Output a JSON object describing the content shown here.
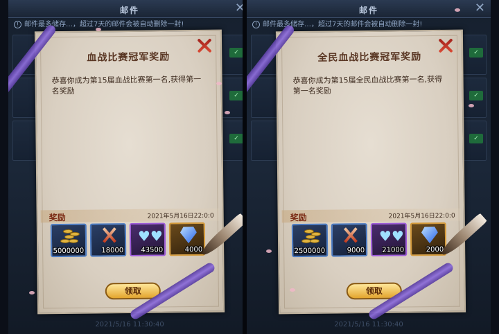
{
  "panels": [
    {
      "window_title": "邮件",
      "notice": "邮件最多储存…，超过7天的邮件会被自动删除一封!",
      "bg_date": "2021/5/16 11:30:40",
      "mail": {
        "title": "血战比赛冠军奖励",
        "body": "恭喜你成为第15届血战比赛第一名,获得第一名奖励",
        "reward_label": "奖励",
        "date": "2021年5月16日22:0:0",
        "rewards": [
          {
            "icon": "gold-coins-icon",
            "qty": "5000000"
          },
          {
            "icon": "crossed-swords-icon",
            "qty": "18000"
          },
          {
            "icon": "blue-hearts-icon",
            "qty": "43500"
          },
          {
            "icon": "diamond-icon",
            "qty": "4000"
          }
        ],
        "claim_label": "领取"
      }
    },
    {
      "window_title": "邮件",
      "notice": "邮件最多储存…，超过7天的邮件会被自动删除一封!",
      "bg_date": "2021/5/16 11:30:40",
      "mail": {
        "title": "全民血战比赛冠军奖励",
        "body": "恭喜你成为第15届全民血战比赛第一名,获得第一名奖励",
        "reward_label": "奖励",
        "date": "2021年5月16日22:0:0",
        "rewards": [
          {
            "icon": "gold-coins-icon",
            "qty": "2500000"
          },
          {
            "icon": "crossed-swords-icon",
            "qty": "9000"
          },
          {
            "icon": "blue-hearts-icon",
            "qty": "21000"
          },
          {
            "icon": "diamond-icon",
            "qty": "2000"
          }
        ],
        "claim_label": "领取"
      }
    }
  ],
  "colors": {
    "paper": "#e2d9cc",
    "title_text": "#5a3724",
    "ribbon": "#7a5bc8",
    "claim_button": "#f0c050",
    "close_x": "#c23a28"
  }
}
